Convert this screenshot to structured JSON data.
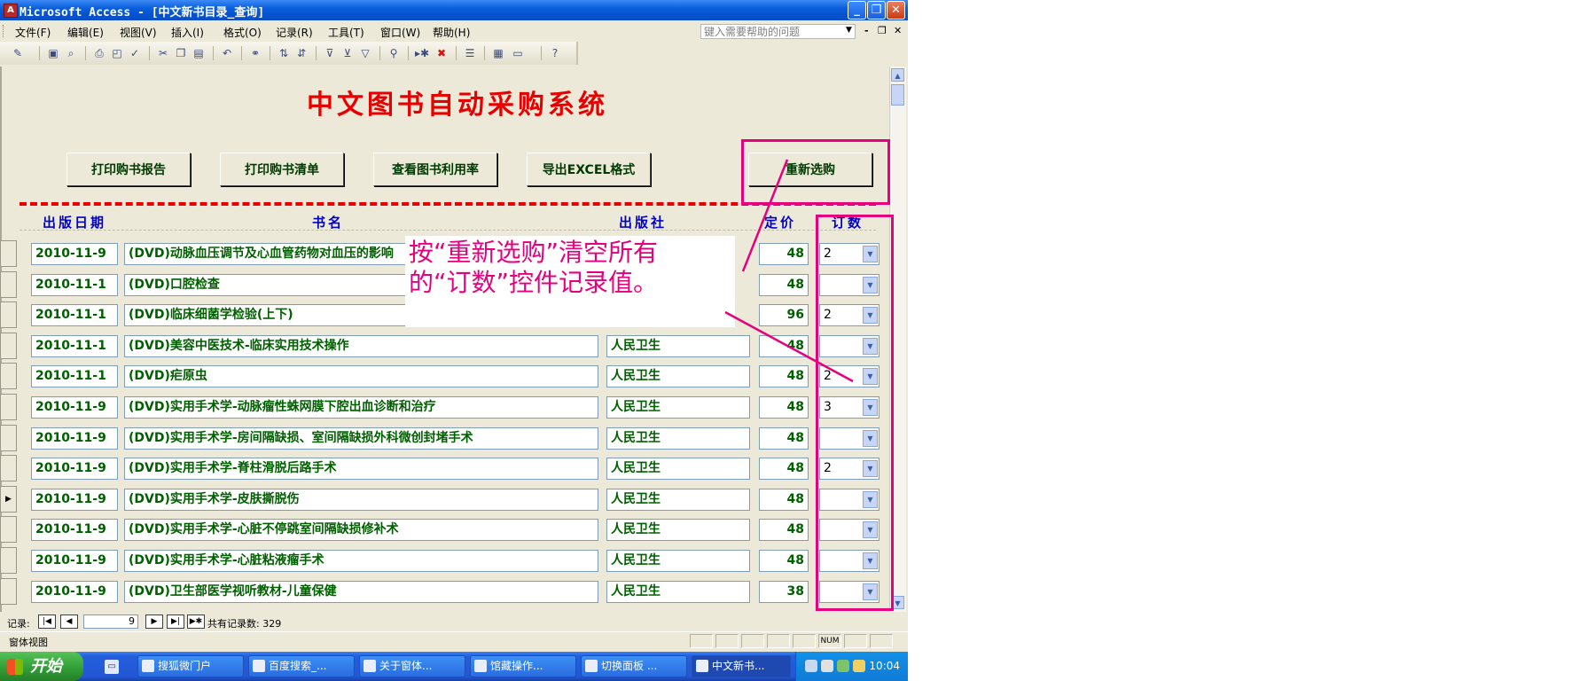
{
  "window": {
    "title": "Microsoft Access - [中文新书目录_查询]",
    "app_icon": "access-key-icon",
    "controls": [
      "_",
      "❐",
      "✕"
    ]
  },
  "menu": {
    "items": [
      "文件(F)",
      "编辑(E)",
      "视图(V)",
      "插入(I)",
      "格式(O)",
      "记录(R)",
      "工具(T)",
      "窗口(W)",
      "帮助(H)"
    ],
    "help_placeholder": "键入需要帮助的问题",
    "mdi_controls": [
      "-",
      "❐",
      "✕"
    ]
  },
  "toolbar": {
    "icons": [
      "design-view-icon",
      "save-icon",
      "file-search-icon",
      "print-icon",
      "print-preview-icon",
      "spelling-icon",
      "cut-icon",
      "copy-icon",
      "paste-icon",
      "undo-icon",
      "hyperlink-icon",
      "sort-ascending-icon",
      "sort-descending-icon",
      "filter-by-selection-icon",
      "filter-by-form-icon",
      "apply-filter-icon",
      "find-icon",
      "new-record-icon",
      "delete-record-icon",
      "properties-icon",
      "database-window-icon",
      "new-object-icon",
      "help-icon"
    ]
  },
  "form": {
    "title": "中文图书自动采购系统",
    "buttons": [
      "打印购书报告",
      "打印购书清单",
      "查看图书利用率",
      "导出EXCEL格式",
      "重新选购"
    ],
    "headers": {
      "date": "出版日期",
      "book": "书名",
      "publisher": "出版社",
      "price": "定价",
      "order": "订数"
    },
    "rows": [
      {
        "date": "2010-11-9",
        "title": "(DVD)动脉血压调节及心血管药物对血压的影响",
        "publisher": "",
        "price": "48",
        "order": "2"
      },
      {
        "date": "2010-11-1",
        "title": "(DVD)口腔检查",
        "publisher": "",
        "price": "48",
        "order": ""
      },
      {
        "date": "2010-11-1",
        "title": "(DVD)临床细菌学检验(上下)",
        "publisher": "",
        "price": "96",
        "order": "2"
      },
      {
        "date": "2010-11-1",
        "title": "(DVD)美容中医技术-临床实用技术操作",
        "publisher": "人民卫生",
        "price": "48",
        "order": ""
      },
      {
        "date": "2010-11-1",
        "title": "(DVD)疟原虫",
        "publisher": "人民卫生",
        "price": "48",
        "order": "2"
      },
      {
        "date": "2010-11-9",
        "title": "(DVD)实用手术学-动脉瘤性蛛网膜下腔出血诊断和治疗",
        "publisher": "人民卫生",
        "price": "48",
        "order": "3"
      },
      {
        "date": "2010-11-9",
        "title": "(DVD)实用手术学-房间隔缺损、室间隔缺损外科微创封堵手术",
        "publisher": "人民卫生",
        "price": "48",
        "order": ""
      },
      {
        "date": "2010-11-9",
        "title": "(DVD)实用手术学-脊柱滑脱后路手术",
        "publisher": "人民卫生",
        "price": "48",
        "order": "2"
      },
      {
        "date": "2010-11-9",
        "title": "(DVD)实用手术学-皮肤撕脱伤",
        "publisher": "人民卫生",
        "price": "48",
        "order": ""
      },
      {
        "date": "2010-11-9",
        "title": "(DVD)实用手术学-心脏不停跳室间隔缺损修补术",
        "publisher": "人民卫生",
        "price": "48",
        "order": ""
      },
      {
        "date": "2010-11-9",
        "title": "(DVD)实用手术学-心脏粘液瘤手术",
        "publisher": "人民卫生",
        "price": "48",
        "order": ""
      },
      {
        "date": "2010-11-9",
        "title": "(DVD)卫生部医学视听教材-儿童保健",
        "publisher": "人民卫生",
        "price": "38",
        "order": ""
      }
    ],
    "current_row": 9
  },
  "annotation": {
    "line1": "按“重新选购”清空所有",
    "line2": "的“订数”控件记录值。",
    "color": "#e6007e"
  },
  "navigation": {
    "label": "记录:",
    "current": "9",
    "total": "共有记录数: 329"
  },
  "status": {
    "text": "窗体视图",
    "num": "NUM"
  },
  "taskbar": {
    "start": "开始",
    "tasks": [
      "搜狐微门户",
      "百度搜索_...",
      "关于窗体...",
      "馆藏操作...",
      "切换面板 ...",
      "中文新书..."
    ],
    "active_task": 5,
    "clock": "10:04"
  }
}
